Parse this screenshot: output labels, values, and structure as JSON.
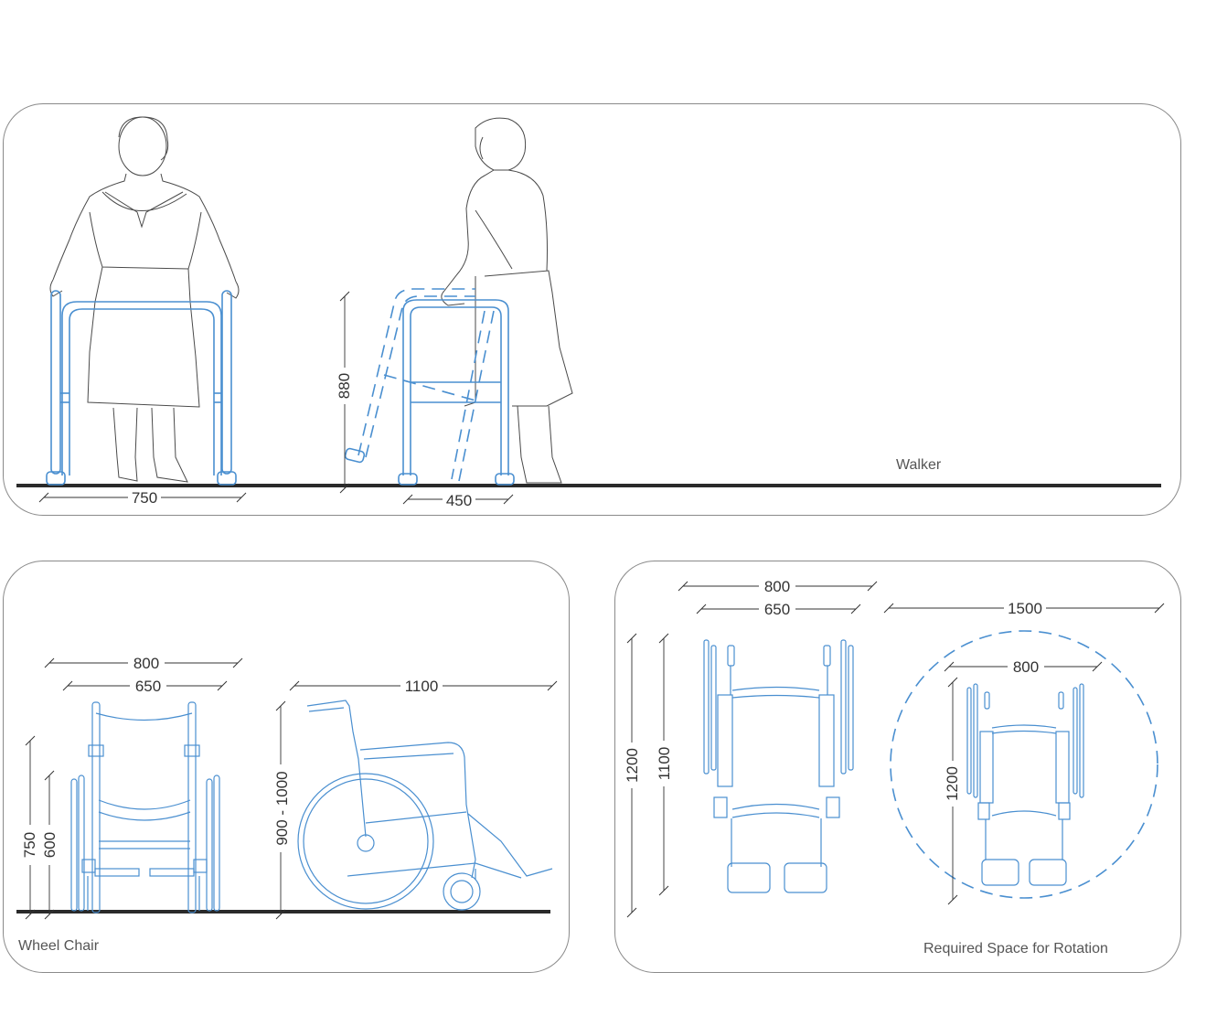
{
  "panels": {
    "walker": {
      "caption": "Walker",
      "dims": {
        "width_front": "750",
        "depth_side": "450",
        "height": "880"
      }
    },
    "wheelchair": {
      "caption": "Wheel Chair",
      "dims": {
        "overall_width": "800",
        "seat_width": "650",
        "length": "1100",
        "height_range": "900 - 1000",
        "armrest_height": "750",
        "seat_height": "600"
      }
    },
    "rotation": {
      "caption": "Required Space for Rotation",
      "dims": {
        "overall_width": "800",
        "seat_width": "650",
        "rotation_diameter": "1500",
        "inner_width": "800",
        "overall_length": "1200",
        "length": "1100",
        "inner_length": "1200"
      }
    }
  },
  "colors": {
    "line_accent": "#4a8fd0",
    "figure_line": "#4a4a4a",
    "floor": "#2a2a2a",
    "panel_border": "#8a8a8a"
  }
}
